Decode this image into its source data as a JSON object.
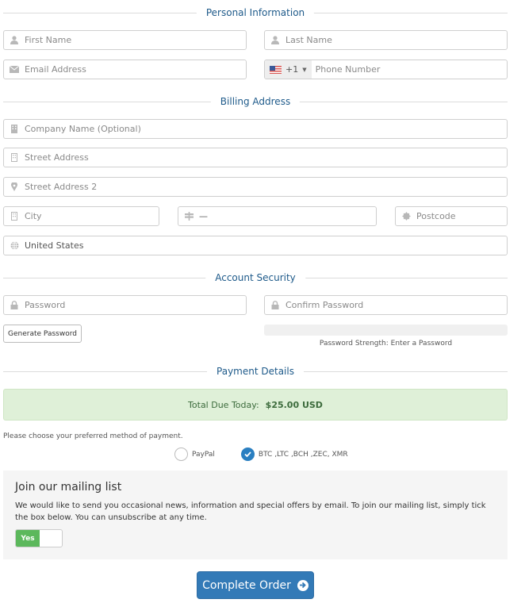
{
  "sections": {
    "personal": "Personal Information",
    "billing": "Billing Address",
    "security": "Account Security",
    "payment": "Payment Details"
  },
  "personal": {
    "first_name_placeholder": "First Name",
    "last_name_placeholder": "Last Name",
    "email_placeholder": "Email Address",
    "phone_country_code": "+1",
    "phone_country_flag": "us-flag",
    "phone_placeholder": "Phone Number"
  },
  "billing": {
    "company_placeholder": "Company Name (Optional)",
    "street_placeholder": "Street Address",
    "street2_placeholder": "Street Address 2",
    "city_placeholder": "City",
    "state_value": "—",
    "postcode_placeholder": "Postcode",
    "country_value": "United States"
  },
  "security": {
    "password_placeholder": "Password",
    "confirm_placeholder": "Confirm Password",
    "generate_label": "Generate Password",
    "strength_text": "Password Strength: Enter a Password",
    "strength_percent": 0
  },
  "payment": {
    "total_label": "Total Due Today:",
    "total_amount": "$25.00 USD",
    "prompt": "Please choose your preferred method of payment.",
    "methods": [
      {
        "label": "PayPal",
        "selected": false
      },
      {
        "label": "BTC ,LTC ,BCH ,ZEC, XMR",
        "selected": true
      }
    ]
  },
  "mailing": {
    "title": "Join our mailing list",
    "description": "We would like to send you occasional news, information and special offers by email. To join our mailing list, simply tick the box below. You can unsubscribe at any time.",
    "toggle_label": "Yes",
    "toggle_on": true
  },
  "submit": {
    "label": "Complete Order"
  },
  "colors": {
    "accent": "#337ab7",
    "section_title": "#1e5a8a",
    "success_bg": "#dff0d8",
    "toggle_on": "#5cb85c"
  }
}
